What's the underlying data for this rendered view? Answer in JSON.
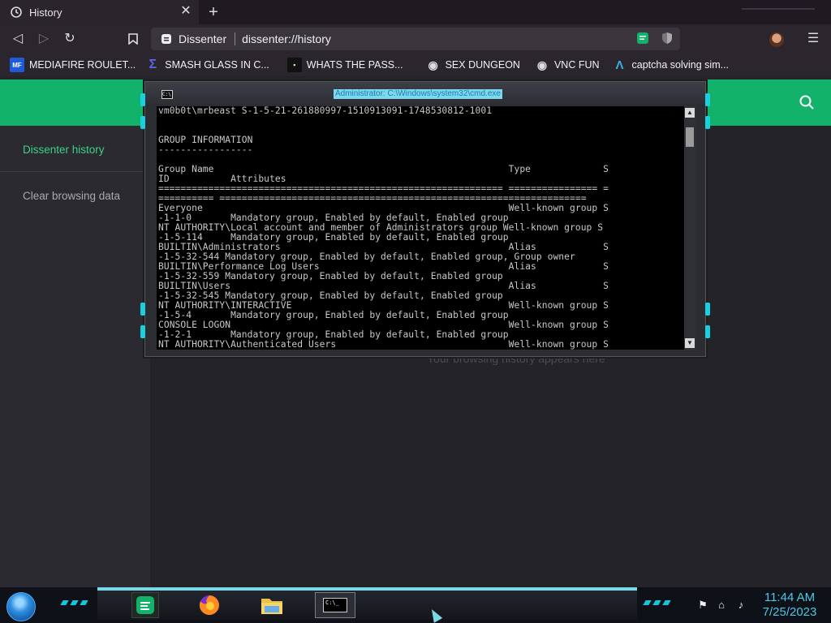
{
  "browser": {
    "tab": {
      "title": "History"
    },
    "urlbar": {
      "site": "Dissenter",
      "url": "dissenter://history"
    },
    "bookmarks": [
      {
        "label": "MEDIAFIRE ROULET...",
        "icon": "mediafire-icon",
        "icon_text": "MF",
        "icon_color": "#1e5bd6"
      },
      {
        "label": "SMASH GLASS IN C...",
        "icon": "sigma-icon",
        "icon_text": "Σ",
        "icon_color": "#3b46c9"
      },
      {
        "label": "WHATS THE PASS...",
        "icon": "lock-icon",
        "icon_text": "▪",
        "icon_color": "#222222"
      },
      {
        "label": "SEX DUNGEON",
        "icon": "vr-headset-icon",
        "icon_text": "◉",
        "icon_color": "#cccccc"
      },
      {
        "label": "VNC FUN",
        "icon": "vr-headset-icon",
        "icon_text": "◉",
        "icon_color": "#cccccc"
      },
      {
        "label": "captcha solving sim...",
        "icon": "a-logo-icon",
        "icon_text": "Λ",
        "icon_color": "#2fb4e6"
      }
    ]
  },
  "page": {
    "sidebar": {
      "history": "Dissenter history",
      "clear": "Clear browsing data"
    },
    "empty_message": "Your browsing history appears here",
    "accent": "#12b26a"
  },
  "cmd": {
    "title": "Administrator: C:\\Windows\\system32\\cmd.exe",
    "lines": [
      "vm0b0t\\mrbeast S-1-5-21-261880997-1510913091-1748530812-1001",
      "",
      "",
      "GROUP INFORMATION",
      "-----------------",
      "",
      "Group Name                                                     Type             S",
      "ID           Attributes",
      "============================================================== ================ =",
      "========== ==================================================================",
      "Everyone                                                       Well-known group S",
      "-1-1-0       Mandatory group, Enabled by default, Enabled group",
      "NT AUTHORITY\\Local account and member of Administrators group Well-known group S",
      "-1-5-114     Mandatory group, Enabled by default, Enabled group",
      "BUILTIN\\Administrators                                         Alias            S",
      "-1-5-32-544 Mandatory group, Enabled by default, Enabled group, Group owner",
      "BUILTIN\\Performance Log Users                                  Alias            S",
      "-1-5-32-559 Mandatory group, Enabled by default, Enabled group",
      "BUILTIN\\Users                                                  Alias            S",
      "-1-5-32-545 Mandatory group, Enabled by default, Enabled group",
      "NT AUTHORITY\\INTERACTIVE                                       Well-known group S",
      "-1-5-4       Mandatory group, Enabled by default, Enabled group",
      "CONSOLE LOGON                                                  Well-known group S",
      "-1-2-1       Mandatory group, Enabled by default, Enabled group",
      "NT AUTHORITY\\Authenticated Users                               Well-known group S"
    ]
  },
  "taskbar": {
    "time": "11:44 AM",
    "date": "7/25/2023"
  }
}
